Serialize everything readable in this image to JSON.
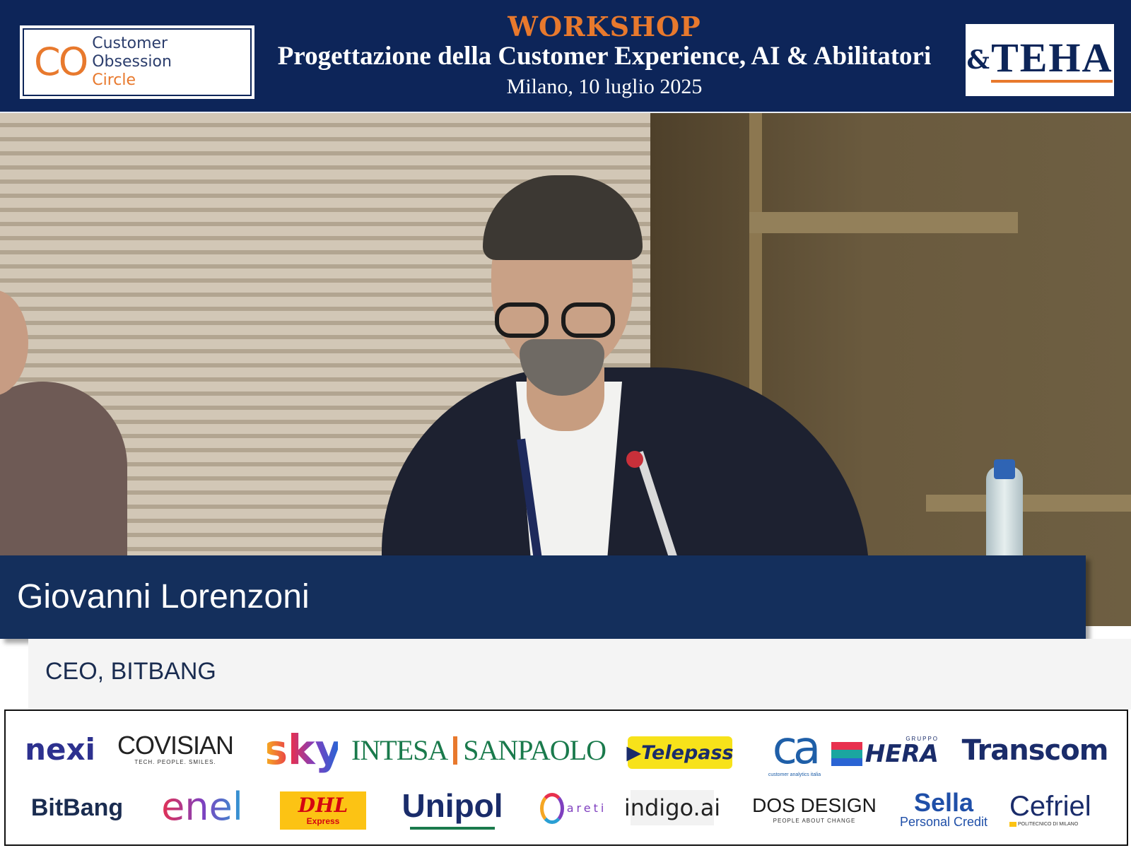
{
  "header": {
    "left_logo": {
      "mark": "CO",
      "line1": "Customer Obsession",
      "line2": "Circle"
    },
    "event_type": "WORKSHOP",
    "title": "Progettazione della Customer Experience, AI & Abilitatori",
    "place_date": "Milano, 10 luglio 2025",
    "right_logo": {
      "mark": "&",
      "word": "TEHA"
    },
    "colors": {
      "banner": "#0d2559",
      "accent": "#e8792d"
    }
  },
  "speaker": {
    "name": "Giovanni Lorenzoni",
    "role": "CEO, BITBANG"
  },
  "sponsors": {
    "row1": [
      {
        "name": "nexi"
      },
      {
        "name": "COVISIAN",
        "tagline": "TECH. PEOPLE. SMILES."
      },
      {
        "name": "sky"
      },
      {
        "name_a": "INTESA",
        "name_b": "SANPAOLO"
      },
      {
        "name": "Telepass"
      },
      {
        "name": "ca",
        "tagline": "customer analytics italia"
      },
      {
        "group": "GRUPPO",
        "name": "HERA"
      },
      {
        "name": "Transcom"
      }
    ],
    "row2": [
      {
        "name": "BitBang"
      },
      {
        "name": "enel"
      },
      {
        "name": "DHL",
        "tagline": "Express"
      },
      {
        "name": "Unipol"
      },
      {
        "name": "areti"
      },
      {
        "name": "indigo.ai"
      },
      {
        "name": "DOS DESIGN",
        "tagline": "PEOPLE ABOUT CHANGE"
      },
      {
        "name": "Sella",
        "tagline": "Personal Credit"
      },
      {
        "name": "Cefriel",
        "tagline": "POLITECNICO DI MILANO"
      }
    ]
  }
}
